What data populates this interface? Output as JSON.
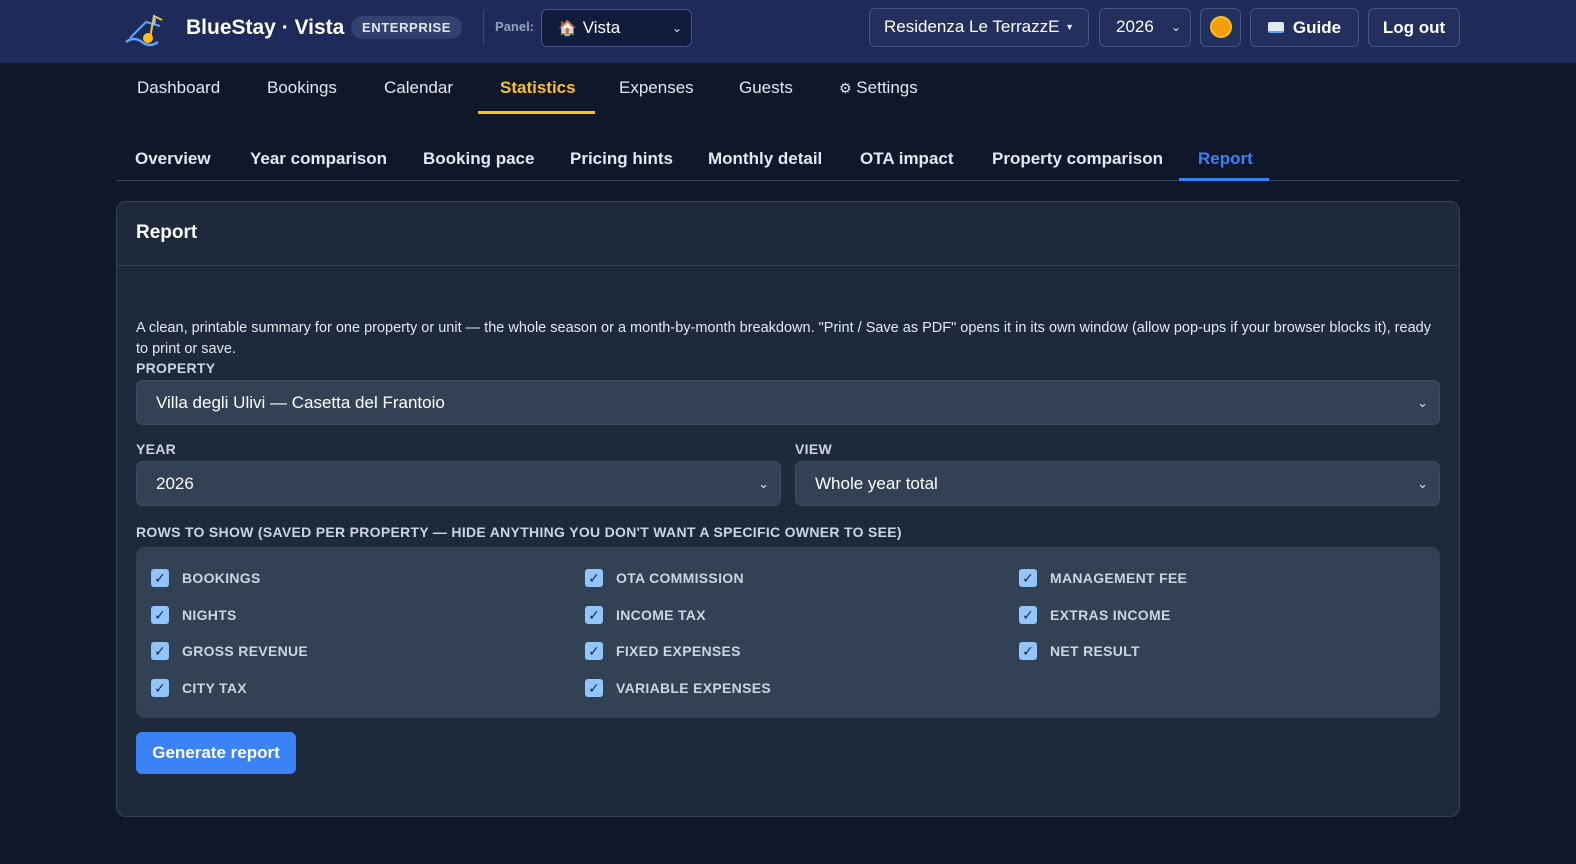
{
  "header": {
    "brand": "BlueStay · Vista",
    "badge": "ENTERPRISE",
    "panel_label": "Panel:",
    "panel_value": "Vista",
    "property_value": "Residenza Le TerrazzE",
    "year_value": "2026",
    "guide_label": "Guide",
    "logout_label": "Log out",
    "icons": [
      "logo-icon",
      "house-icon",
      "chevron-down-icon",
      "sun-icon",
      "book-icon"
    ]
  },
  "main_nav": {
    "items": [
      "Dashboard",
      "Bookings",
      "Calendar",
      "Statistics",
      "Expenses",
      "Guests",
      "Settings"
    ],
    "settings_icon": "⚙",
    "active": "Statistics"
  },
  "sub_tabs": {
    "items": [
      "Overview",
      "Year comparison",
      "Booking pace",
      "Pricing hints",
      "Monthly detail",
      "OTA impact",
      "Property comparison",
      "Report"
    ],
    "active": "Report"
  },
  "report": {
    "title": "Report",
    "description": "A clean, printable summary for one property or unit — the whole season or a month-by-month breakdown. \"Print / Save as PDF\" opens it in its own window (allow pop-ups if your browser blocks it), ready to print or save.",
    "property_label": "PROPERTY",
    "property_value": "Villa degli Ulivi — Casetta del Frantoio",
    "year_label": "YEAR",
    "year_value": "2026",
    "view_label": "VIEW",
    "view_value": "Whole year total",
    "rows_label": "ROWS TO SHOW (SAVED PER PROPERTY — HIDE ANYTHING YOU DON'T WANT A SPECIFIC OWNER TO SEE)",
    "rows": [
      {
        "label": "BOOKINGS",
        "checked": true
      },
      {
        "label": "NIGHTS",
        "checked": true
      },
      {
        "label": "GROSS REVENUE",
        "checked": true
      },
      {
        "label": "CITY TAX",
        "checked": true
      },
      {
        "label": "OTA COMMISSION",
        "checked": true
      },
      {
        "label": "INCOME TAX",
        "checked": true
      },
      {
        "label": "FIXED EXPENSES",
        "checked": true
      },
      {
        "label": "VARIABLE EXPENSES",
        "checked": true
      },
      {
        "label": "MANAGEMENT FEE",
        "checked": true
      },
      {
        "label": "EXTRAS INCOME",
        "checked": true
      },
      {
        "label": "NET RESULT",
        "checked": true
      }
    ],
    "generate_label": "Generate report"
  },
  "colors": {
    "background": "#0f172a",
    "topbar": "#1e2a5a",
    "card": "#1e293b",
    "accent_active_nav": "#fbbf24",
    "accent_active_tab": "#3b82f6",
    "primary_button": "#3b82f6",
    "checkbox": "#93c5fd"
  }
}
